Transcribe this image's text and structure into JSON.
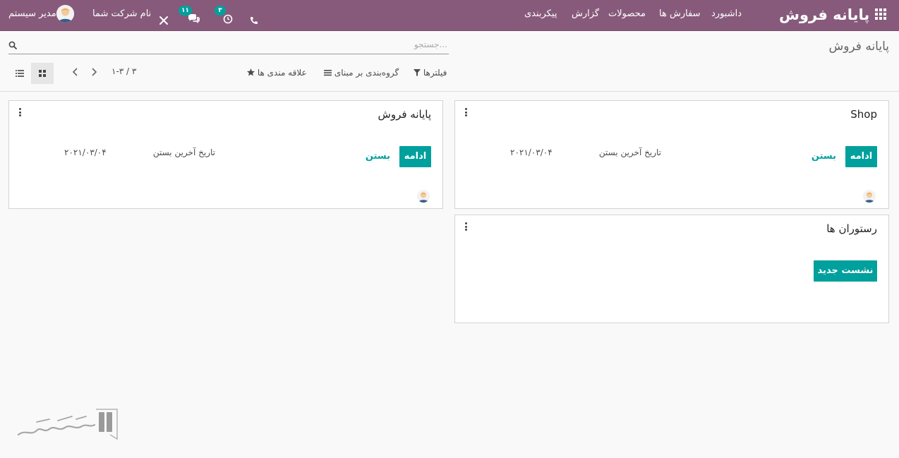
{
  "navbar": {
    "brand": "پایانه فروش",
    "menu": [
      "داشبورد",
      "سفارش ها",
      "محصولات",
      "گزارش",
      "پیکربندی"
    ],
    "activity_count": "۳",
    "messages_count": "۱۱",
    "company": "نام شرکت شما",
    "user": "مدیر سیستم"
  },
  "control_panel": {
    "title": "پایانه فروش",
    "search_placeholder": "جستجو...",
    "filters_label": "فیلترها",
    "groupby_label": "گروه‌بندی بر مبنای",
    "favorites_label": "علاقه مندی ها",
    "pager": "۱-۳ / ۳"
  },
  "cards": [
    {
      "title": "Shop",
      "resume_label": "ادامه",
      "close_label": "بستن",
      "last_closing_label": "تاریخ آخرین بستن",
      "last_closing_date": "۲۰۲۱/۰۳/۰۴"
    },
    {
      "title": "پایانه فروش",
      "resume_label": "ادامه",
      "close_label": "بستن",
      "last_closing_label": "تاریخ آخرین بستن",
      "last_closing_date": "۲۰۲۱/۰۳/۰۴"
    },
    {
      "title": "رستوران ها",
      "new_session_label": "نشست جدید"
    }
  ],
  "colors": {
    "navbar": "#875a7b",
    "primary": "#00a09d",
    "background": "#f9f9f9"
  },
  "icons": [
    "apps-grid-icon",
    "phone-icon",
    "clock-icon",
    "chat-icon",
    "tools-icon",
    "search-icon",
    "filter-icon",
    "list-icon",
    "star-icon",
    "kanban-icon",
    "list-view-icon",
    "chevron-left-icon",
    "chevron-right-icon",
    "kebab-menu-icon"
  ]
}
